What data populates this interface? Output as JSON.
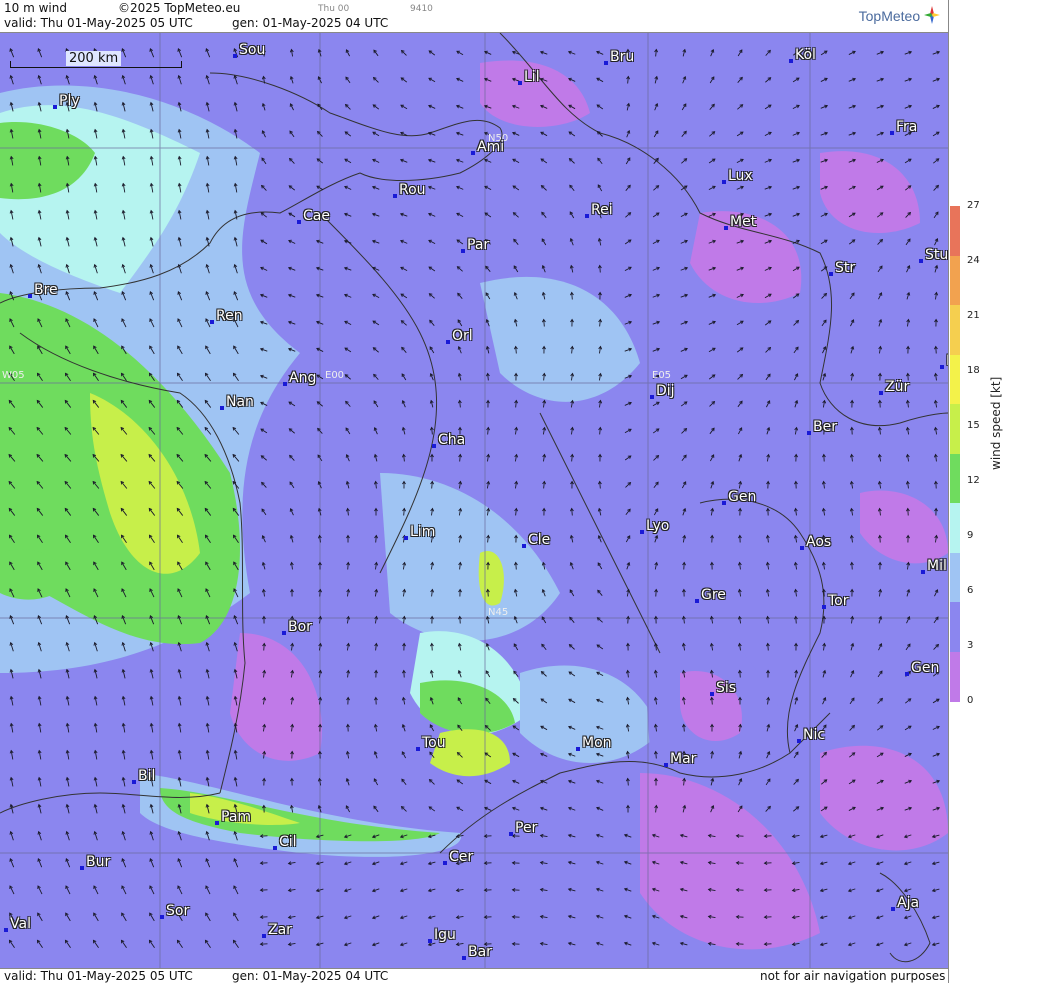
{
  "header": {
    "product": "10 m wind",
    "copyright": "©2025 TopMeteo.eu",
    "small_day": "Thu 00",
    "small_code": "9410",
    "valid": "valid:  Thu  01-May-2025  05 UTC",
    "gen": "gen: 01-May-2025 04 UTC",
    "logo": "TopMeteo"
  },
  "footer": {
    "valid": "valid:  Thu  01-May-2025  05 UTC",
    "gen": "gen: 01-May-2025 04 UTC",
    "disclaimer": "not for air navigation purposes"
  },
  "scale": {
    "label": "200 km"
  },
  "legend": {
    "title": "wind speed [kt]",
    "ticks": [
      "27",
      "24",
      "21",
      "18",
      "15",
      "12",
      "9",
      "6",
      "3",
      "0"
    ],
    "colors": [
      "#e8745a",
      "#f2a24f",
      "#f5cf4f",
      "#f3f24a",
      "#c7ef4a",
      "#6fdc5e",
      "#b6f4f0",
      "#9fc4f3",
      "#8b86ef",
      "#c07ae8"
    ]
  },
  "grid_labels": [
    "N50",
    "N45",
    "W05",
    "E00",
    "E05"
  ],
  "cities": [
    {
      "name": "Sou"
    },
    {
      "name": "Bru"
    },
    {
      "name": "Köl"
    },
    {
      "name": "Lil"
    },
    {
      "name": "Ply"
    },
    {
      "name": "Ami"
    },
    {
      "name": "Fra"
    },
    {
      "name": "Lux"
    },
    {
      "name": "Rou"
    },
    {
      "name": "Cae"
    },
    {
      "name": "Rei"
    },
    {
      "name": "Met"
    },
    {
      "name": "Par"
    },
    {
      "name": "Str"
    },
    {
      "name": "Stu"
    },
    {
      "name": "Bre"
    },
    {
      "name": "Ren"
    },
    {
      "name": "Orl"
    },
    {
      "name": "Ang"
    },
    {
      "name": "Nan"
    },
    {
      "name": "Dij"
    },
    {
      "name": "Zür"
    },
    {
      "name": "Ber"
    },
    {
      "name": "Cha"
    },
    {
      "name": "Gen"
    },
    {
      "name": "Lim"
    },
    {
      "name": "Cle"
    },
    {
      "name": "Lyo"
    },
    {
      "name": "Aos"
    },
    {
      "name": "Mil"
    },
    {
      "name": "Gre"
    },
    {
      "name": "Tor"
    },
    {
      "name": "Bor"
    },
    {
      "name": "Sis"
    },
    {
      "name": "Gen"
    },
    {
      "name": "Tou"
    },
    {
      "name": "Mon"
    },
    {
      "name": "Mar"
    },
    {
      "name": "Nic"
    },
    {
      "name": "Bil"
    },
    {
      "name": "Pam"
    },
    {
      "name": "Per"
    },
    {
      "name": "Cil"
    },
    {
      "name": "Bur"
    },
    {
      "name": "Cer"
    },
    {
      "name": "Sor"
    },
    {
      "name": "Aja"
    },
    {
      "name": "Val"
    },
    {
      "name": "Zar"
    },
    {
      "name": "Igu"
    },
    {
      "name": "Bar"
    },
    {
      "name": "F"
    }
  ]
}
